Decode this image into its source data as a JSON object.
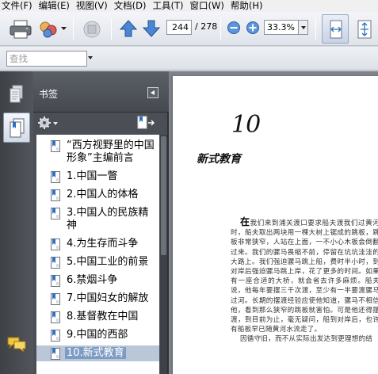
{
  "menu": [
    "文件(F)",
    "编辑(E)",
    "视图(V)",
    "文档(D)",
    "工具(T)",
    "窗口(W)",
    "帮助(H)"
  ],
  "toolbar": {
    "current_page": "244",
    "page_total": "/ 278",
    "zoom": "33.3%",
    "icons": [
      "print-icon",
      "collaborate-icon",
      "save-icon",
      "previous-page-icon",
      "next-page-icon",
      "zoom-out-icon",
      "zoom-in-icon",
      "fit-width-icon",
      "fit-page-icon"
    ]
  },
  "search": {
    "placeholder": "查找"
  },
  "panel": {
    "title": "书签",
    "bookmarks": [
      "“西方视野里的中国形象”主编前言",
      "1.中国一瞥",
      "2.中国人的体格",
      "3.中国人的民族精神",
      "4.为生存而斗争",
      "5.中国工业的前景",
      "6.禁烟斗争",
      "7.中国妇女的解放",
      "8.基督教在中国",
      "9.中国的西部",
      "10.新式教育"
    ],
    "selected_index": 10
  },
  "document": {
    "chapter_number": "10",
    "chapter_title": "新式教育",
    "paragraphs": [
      "在我们来到浦关渡口要求船夫渡我们过黄河时，船夫取出两块用一棵大树上锯成的跳板，跳板非常狭窄，人站在上面，一不小心木板会倒翻过来。我们的骡马畏缩不前，停留在坑坑洼洼的大路上。我们强迫骡马跳上船，费时半小时，到对岸后强迫骡马跳上岸，花了更多的时间。如果有一座合适的大桥，就会省去许多麻烦。船夫说，他每年要摆三千次渡，至少有一半要渡骡马过河。长期的摆渡经验应使他知道，骡马不相信他，看到那么狭窄的跳板就害怕。可是他还得摆渡，到目前为止，毫无疑问，船到对岸后，也许有船板早已随黄河水流走了。",
      "因循守旧，而不从实际出发达到更理想的结"
    ]
  },
  "colors": {
    "accent": "#7e9cc3",
    "panel": "#4b4f55",
    "nav_strip": "#3e4247"
  }
}
